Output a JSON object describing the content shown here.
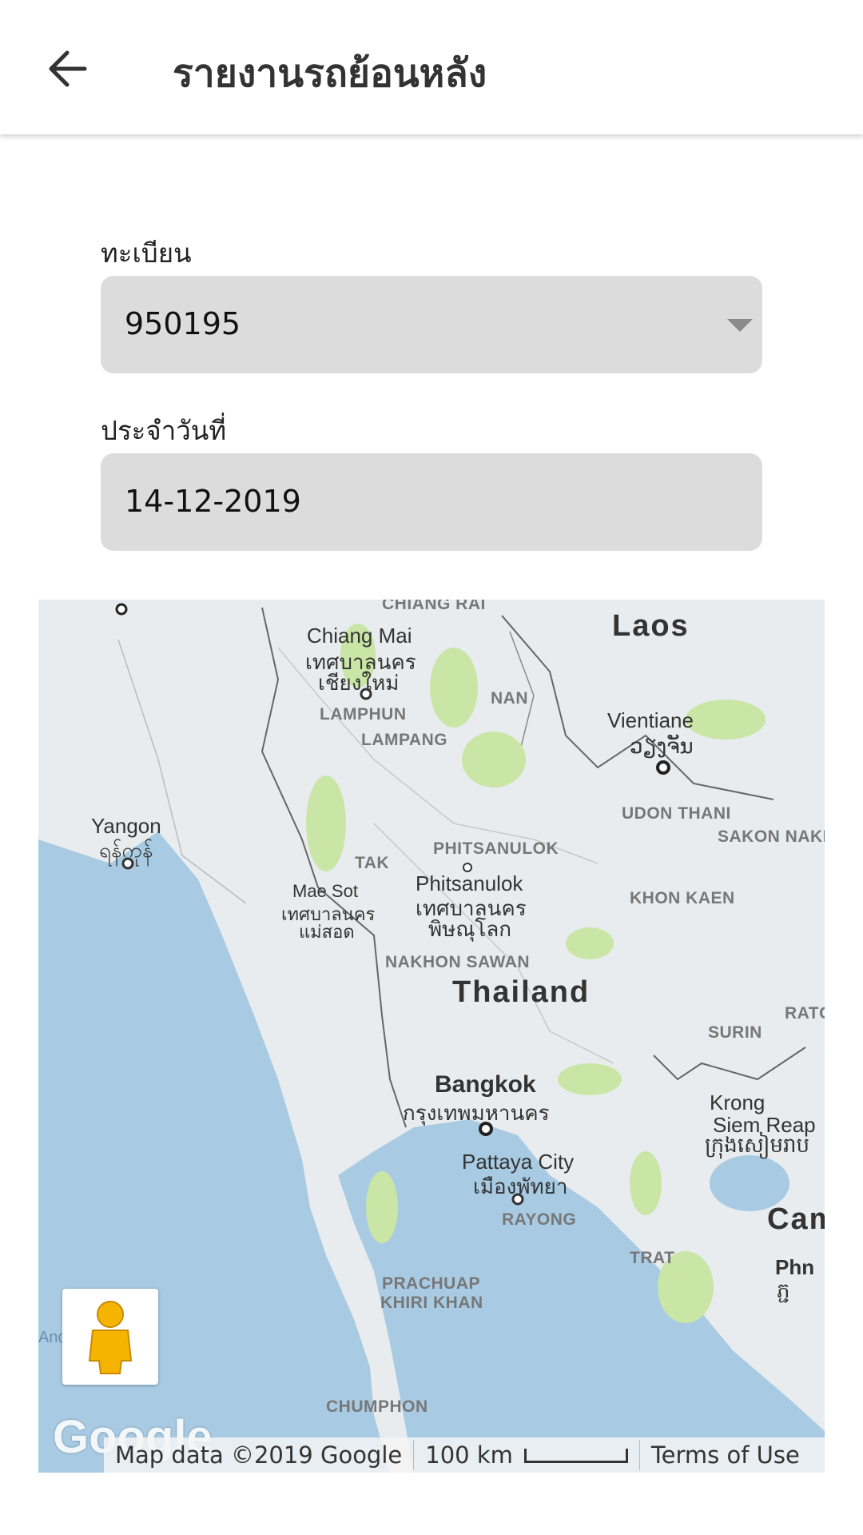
{
  "header": {
    "title": "รายงานรถย้อนหลัง",
    "back_icon": "arrow-left-icon"
  },
  "form": {
    "plate_label": "ทะเบียน",
    "plate_value": "950195",
    "date_label": "ประจำวันที่",
    "date_value": "14-12-2019"
  },
  "map": {
    "labels": {
      "laos": "Laos",
      "chiang_mai": "Chiang Mai",
      "chiang_mai_th1": "เทศบาลนคร",
      "chiang_mai_th2": "เชียงใหม่",
      "lamphun": "LAMPHUN",
      "lampang": "LAMPANG",
      "nan": "NAN",
      "vientiane": "Vientiane",
      "vientiane_lo": "ວຽງຈັນ",
      "udon_thani": "UDON THANI",
      "sakon": "SAKON NAKH",
      "yangon": "Yangon",
      "yangon_my": "ရန်ကုန်",
      "tak": "TAK",
      "phitsanulok_prov": "PHITSANULOK",
      "mae_sot": "Mae Sot",
      "mae_sot_th1": "เทศบาลนคร",
      "mae_sot_th2": "แม่สอด",
      "phitsanulok": "Phitsanulok",
      "phitsanulok_th1": "เทศบาลนคร",
      "phitsanulok_th2": "พิษณุโลก",
      "khon_kaen": "KHON KAEN",
      "nakhon_sawan": "NAKHON SAWAN",
      "thailand": "Thailand",
      "ratc": "RATC",
      "surin": "SURIN",
      "bangkok": "Bangkok",
      "bangkok_th": "กรุงเทพมหานคร",
      "krong": "Krong",
      "siem_reap": "Siem Reap",
      "siem_reap_km": "ក្រុងសៀមរាប",
      "pattaya": "Pattaya City",
      "pattaya_th": "เมืองพัทยา",
      "rayong": "RAYONG",
      "cam": "Cam",
      "trat": "TRAT",
      "phn": "Phn",
      "phn_km": "ភ្ជ",
      "prachuap": "PRACHUAP",
      "khiri": "KHIRI KHAN",
      "chumphon": "CHUMPHON",
      "chiang_rai": "CHIANG RAI",
      "and": "And"
    },
    "logo": "Google",
    "attribution": "Map data ©2019 Google",
    "scale": "100 km",
    "terms": "Terms of Use",
    "pegman_icon": "pegman-icon",
    "colors": {
      "water": "#a8cbe3",
      "land": "#e9ecee",
      "park": "#c9e6a6"
    }
  }
}
